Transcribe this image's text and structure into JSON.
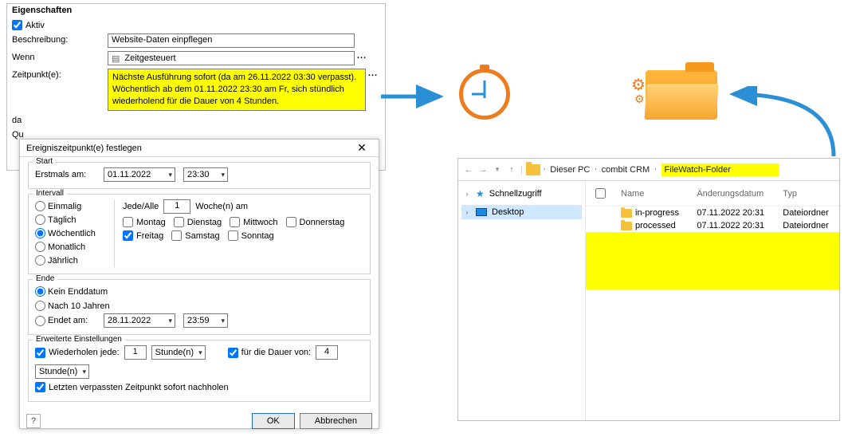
{
  "props": {
    "title": "Eigenschaften",
    "aktiv_label": "Aktiv",
    "aktiv_checked": true,
    "beschreibung_label": "Beschreibung:",
    "beschreibung_value": "Website-Daten einpflegen",
    "wenn_label": "Wenn",
    "wenn_value": "Zeitgesteuert",
    "zeitpunkt_label": "Zeitpunkt(e):",
    "zeitpunkt_text": "Nächste Ausführung sofort (da am 26.11.2022 03:30 verpasst). Wöchentlich ab dem 01.11.2022 23:30 am Fr, sich stündlich wiederholend für die Dauer von 4 Stunden.",
    "da_label": "da",
    "q_label": "Qu"
  },
  "dlg": {
    "title": "Ereigniszeitpunkt(e) festlegen",
    "start": {
      "legend": "Start",
      "erstmals_label": "Erstmals am:",
      "date": "01.11.2022",
      "time": "23:30"
    },
    "intervall": {
      "legend": "Intervall",
      "options": [
        "Einmalig",
        "Täglich",
        "Wöchentlich",
        "Monatlich",
        "Jährlich"
      ],
      "selected": "Wöchentlich",
      "jedealle_label": "Jede/Alle",
      "jedealle_value": "1",
      "wochen_am": "Woche(n) am",
      "days": [
        "Montag",
        "Dienstag",
        "Mittwoch",
        "Donnerstag",
        "Freitag",
        "Samstag",
        "Sonntag"
      ],
      "checked_days": [
        "Freitag"
      ]
    },
    "ende": {
      "legend": "Ende",
      "opt1": "Kein Enddatum",
      "opt2": "Nach 10 Jahren",
      "opt3": "Endet am:",
      "selected": "Kein Enddatum",
      "end_date": "28.11.2022",
      "end_time": "23:59"
    },
    "erw": {
      "legend": "Erweiterte Einstellungen",
      "wieder_label": "Wiederholen jede:",
      "wieder_value": "1",
      "wieder_unit": "Stunde(n)",
      "dauer_label": "für die Dauer von:",
      "dauer_value": "4",
      "dauer_unit": "Stunde(n)",
      "letzten_label": "Letzten verpassten Zeitpunkt sofort nachholen"
    },
    "ok": "OK",
    "cancel": "Abbrechen"
  },
  "explorer": {
    "breadcrumb": [
      "Dieser PC",
      "combit CRM",
      "FileWatch-Folder"
    ],
    "quick": "Schnellzugriff",
    "desktop": "Desktop",
    "cols": [
      "Name",
      "Änderungsdatum",
      "Typ"
    ],
    "rows": [
      {
        "name": "in-progress",
        "date": "07.11.2022 20:31",
        "type": "Dateiordner"
      },
      {
        "name": "processed",
        "date": "07.11.2022 20:31",
        "type": "Dateiordner"
      }
    ]
  }
}
